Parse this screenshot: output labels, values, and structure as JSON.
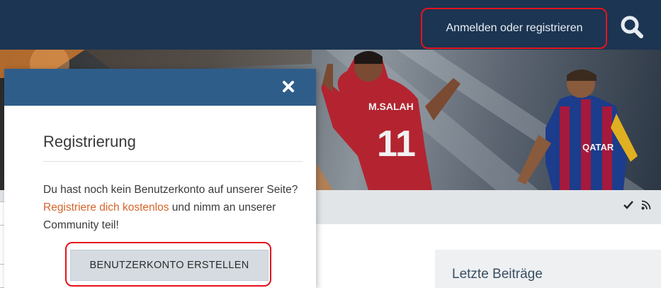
{
  "header": {
    "login_label": "Anmelden oder registrieren",
    "search_icon": "search-icon",
    "background_color": "#1c3552"
  },
  "banner": {
    "player_left_jersey_name": "M.SALAH",
    "player_left_jersey_number": "11",
    "player_right_jersey_sponsor": "QATAR"
  },
  "strip": {
    "icons": [
      "check-icon",
      "rss-icon"
    ]
  },
  "sidebar": {
    "latest_posts_title": "Letzte Beiträge"
  },
  "overlay": {
    "header_color": "#2f5d8a",
    "close_icon": "close-icon",
    "title": "Registrierung",
    "text_before_link": "Du hast noch kein Benutzerkonto auf unserer Seite? ",
    "link_text": "Registriere dich kostenlos",
    "text_after_link": " und nimm an unserer Community teil!",
    "create_account_button": "BENUTZERKONTO ERSTELLEN",
    "link_color": "#d6642a"
  },
  "highlight_color": "#e4141c"
}
